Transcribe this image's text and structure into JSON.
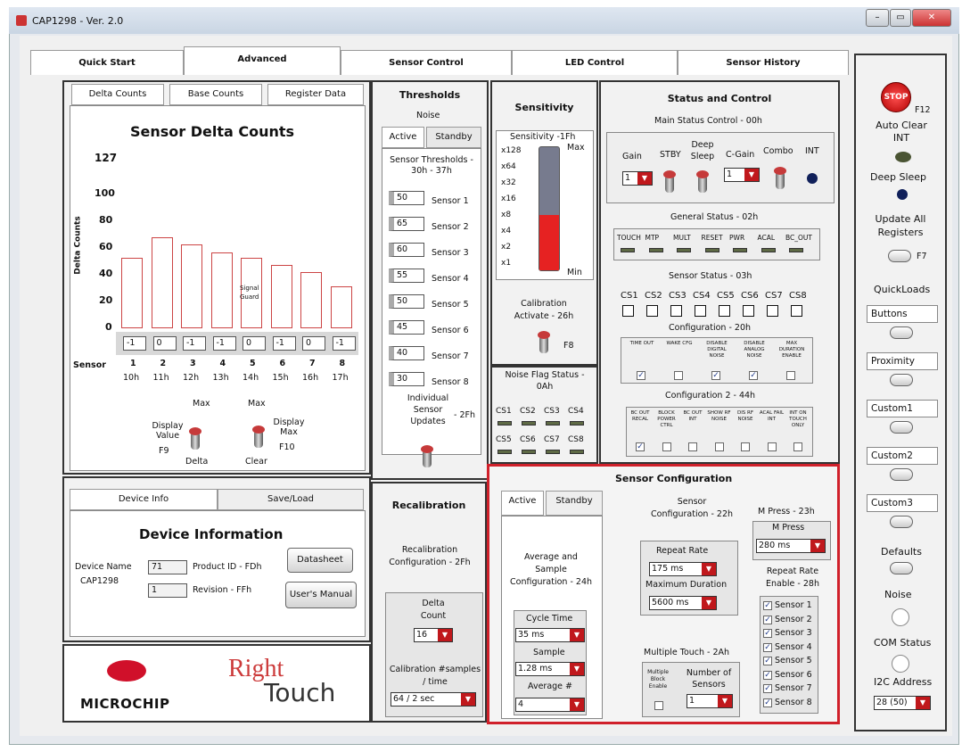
{
  "window": {
    "title": "CAP1298 - Ver. 2.0",
    "min": "–",
    "max": "▭",
    "close": "✕"
  },
  "tabs": [
    "Quick Start",
    "Advanced",
    "Sensor Control",
    "LED Control",
    "Sensor History"
  ],
  "delta": {
    "subtabs": [
      "Delta Counts",
      "Base Counts",
      "Register Data"
    ],
    "title": "Sensor Delta Counts",
    "ylabel": "Delta Counts",
    "yticks": [
      "127",
      "100",
      "80",
      "60",
      "40",
      "20",
      "0"
    ],
    "sensor_label": "Sensor",
    "inputs": [
      "-1",
      "0",
      "-1",
      "-1",
      "0",
      "-1",
      "0",
      "-1"
    ],
    "sensors": [
      "1",
      "2",
      "3",
      "4",
      "5",
      "6",
      "7",
      "8"
    ],
    "regs": [
      "10h",
      "11h",
      "12h",
      "13h",
      "14h",
      "15h",
      "16h",
      "17h"
    ],
    "signal_guard": "Signal Guard",
    "max1": "Max",
    "max2": "Max",
    "display_value": "Display Value",
    "f9": "F9",
    "delta_lbl": "Delta",
    "display_max": "Display Max",
    "f10": "F10",
    "clear_lbl": "Clear"
  },
  "chart_data": {
    "type": "bar",
    "categories": [
      "1",
      "2",
      "3",
      "4",
      "5",
      "6",
      "7",
      "8"
    ],
    "values": [
      50,
      65,
      60,
      54,
      50,
      45,
      40,
      30
    ],
    "ylim": [
      0,
      127
    ],
    "ylabel": "Delta Counts",
    "xlabel": "Sensor"
  },
  "thresholds": {
    "title": "Thresholds",
    "noise": "Noise",
    "active": "Active",
    "standby": "Standby",
    "sub": "Sensor Thresholds - 30h - 37h",
    "values": [
      "50",
      "65",
      "60",
      "55",
      "50",
      "45",
      "40",
      "30"
    ],
    "names": [
      "Sensor 1",
      "Sensor 2",
      "Sensor 3",
      "Sensor 4",
      "Sensor 5",
      "Sensor 6",
      "Sensor 7",
      "Sensor 8"
    ],
    "indiv": "Individual Sensor Updates",
    "indiv_reg": "- 2Fh"
  },
  "sensitivity": {
    "title": "Sensitivity",
    "sub": "Sensitivity -1Fh",
    "max": "Max",
    "min": "Min",
    "level": 0.45,
    "ticks": [
      "x128",
      "x64",
      "x32",
      "x16",
      "x8",
      "x4",
      "x2",
      "x1"
    ],
    "calib": "Calibration Activate - 26h",
    "f8": "F8"
  },
  "noise_flag": {
    "title": "Noise Flag Status - 0Ah",
    "row1": [
      "CS1",
      "CS2",
      "CS3",
      "CS4"
    ],
    "row2": [
      "CS5",
      "CS6",
      "CS7",
      "CS8"
    ]
  },
  "status": {
    "title": "Status and Control",
    "main": "Main Status Control - 00h",
    "gain": "Gain",
    "stby": "STBY",
    "deep": "Deep Sleep",
    "cgain": "C-Gain",
    "combo": "Combo",
    "int": "INT",
    "gain_val": "1",
    "cgain_val": "1",
    "general": "General Status - 02h",
    "general_items": [
      "TOUCH",
      "MTP",
      "MULT",
      "RESET",
      "PWR",
      "ACAL",
      "BC_OUT"
    ],
    "sensor_status": "Sensor Status - 03h",
    "cs": [
      "CS1",
      "CS2",
      "CS3",
      "CS4",
      "CS5",
      "CS6",
      "CS7",
      "CS8"
    ],
    "config": "Configuration - 20h",
    "config_items": [
      "TIME OUT",
      "WAKE CFG",
      "DISABLE DIGITAL NOISE",
      "DISABLE ANALOG NOISE",
      "MAX DURATION ENABLE"
    ],
    "config2": "Configuration 2 - 44h",
    "config2_items": [
      "BC OUT RECAL",
      "BLOCK POWER CTRL",
      "BC OUT INT",
      "SHOW RF NOISE",
      "DIS RF NOISE",
      "ACAL FAIL INT",
      "INT ON TOUCH ONLY"
    ]
  },
  "device": {
    "tabs": [
      "Device Info",
      "Save/Load"
    ],
    "title": "Device Information",
    "name_lbl": "Device Name",
    "name": "CAP1298",
    "pid_val": "71",
    "pid_lbl": "Product ID - FDh",
    "rev_val": "1",
    "rev_lbl": "Revision - FFh",
    "datasheet": "Datasheet",
    "manual": "User's Manual"
  },
  "logos": {
    "microchip": "MICROCHIP",
    "right": "Right",
    "touch": "Touch"
  },
  "recal": {
    "title": "Recalibration",
    "conf": "Recalibration Configuration - 2Fh",
    "delta": "Delta Count",
    "delta_val": "16",
    "calib": "Calibration #samples / time",
    "calib_val": "64 / 2 sec"
  },
  "sensor_config": {
    "title": "Sensor Configuration",
    "active": "Active",
    "standby": "Standby",
    "avg": "Average and Sample Configuration - 24h",
    "cycle": "Cycle Time",
    "cycle_val": "35 ms",
    "sample": "Sample",
    "sample_val": "1.28 ms",
    "avgn": "Average #",
    "avgn_val": "4",
    "sc22": "Sensor Configuration - 22h",
    "repeat": "Repeat Rate",
    "repeat_val": "175 ms",
    "maxdur": "Maximum Duration",
    "maxdur_val": "5600 ms",
    "mpress_title": "M Press - 23h",
    "mpress": "M Press",
    "mpress_val": "280 ms",
    "rre": "Repeat Rate Enable - 28h",
    "rre_items": [
      "Sensor 1",
      "Sensor 2",
      "Sensor 3",
      "Sensor 4",
      "Sensor 5",
      "Sensor 6",
      "Sensor 7",
      "Sensor 8"
    ],
    "multi": "Multiple Touch - 2Ah",
    "mbe": "Multiple Block Enable",
    "num": "Number of Sensors",
    "num_val": "1"
  },
  "right": {
    "stop": "STOP",
    "f12": "F12",
    "auto": "Auto Clear INT",
    "deep": "Deep Sleep",
    "update": "Update All Registers",
    "f7": "F7",
    "quick": "QuickLoads",
    "items": [
      "Buttons",
      "Proximity",
      "Custom1",
      "Custom2",
      "Custom3"
    ],
    "defaults": "Defaults",
    "noise": "Noise",
    "com": "COM Status",
    "i2c": "I2C Address",
    "i2c_val": "28 (50)"
  }
}
